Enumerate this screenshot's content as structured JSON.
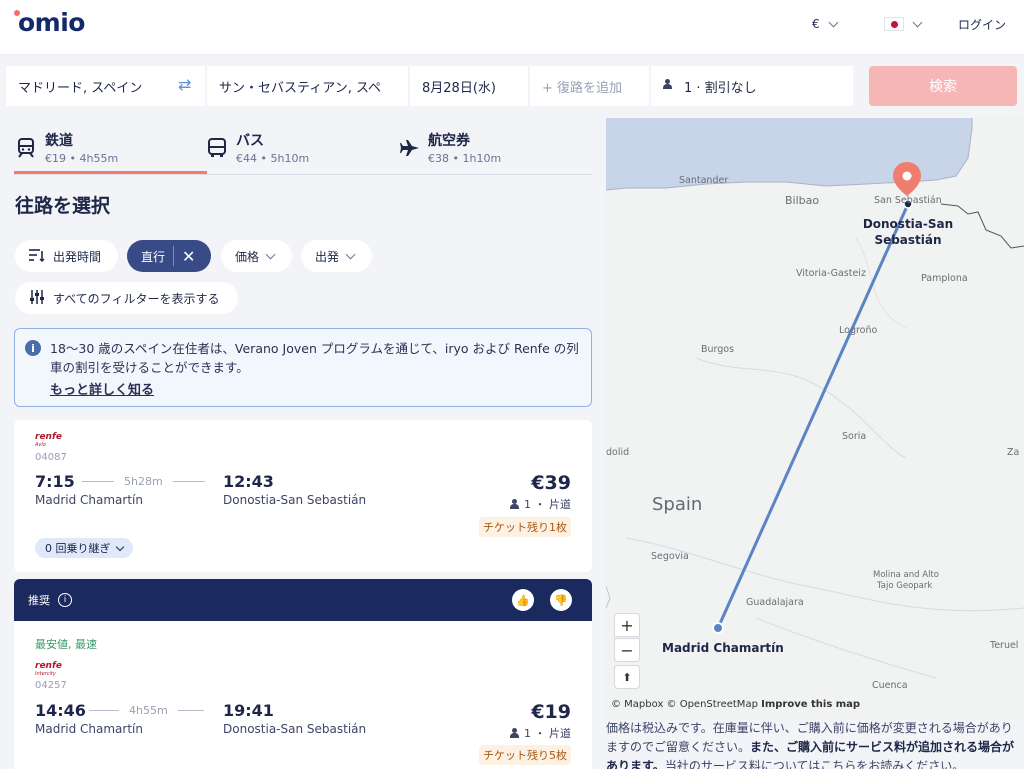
{
  "header": {
    "logo": "omio",
    "currency": "€",
    "login": "ログイン"
  },
  "search": {
    "origin": "マドリード, スペイン",
    "destination": "サン・セバスティアン, スペ",
    "date": "8月28日(水)",
    "return_placeholder": "+ 復路を追加",
    "passengers": "1 · 割引なし",
    "search_button": "検索"
  },
  "tabs": [
    {
      "name": "鉄道",
      "meta": "€19 • 4h55m"
    },
    {
      "name": "バス",
      "meta": "€44 • 5h10m"
    },
    {
      "name": "航空券",
      "meta": "€38 • 1h10m"
    }
  ],
  "section_title": "往路を選択",
  "filters": {
    "departure_time": "出発時間",
    "direct": "直行",
    "price": "価格",
    "departure": "出発",
    "all_filters": "すべてのフィルターを表示する"
  },
  "info": {
    "text": "18〜30 歳のスペイン在住者は、Verano Joven プログラムを通じて、iryo および Renfe の列車の割引を受けることができます。",
    "link": "もっと詳しく知る"
  },
  "results": [
    {
      "brand": "renfe",
      "brand_sub": "Avlo",
      "train_no": "04087",
      "dep_time": "7:15",
      "duration": "5h28m",
      "arr_time": "12:43",
      "dep_station": "Madrid Chamartín",
      "arr_station": "Donostia-San Sebastián",
      "price": "€39",
      "pax": "1 ・ 片道",
      "seats_left": "チケット残り1枚",
      "stops": "0 回乗り継ぎ"
    },
    {
      "recommended": "推奨",
      "tag": "最安値, 最速",
      "brand": "renfe",
      "brand_sub": "Intercity",
      "train_no": "04257",
      "dep_time": "14:46",
      "duration": "4h55m",
      "arr_time": "19:41",
      "dep_station": "Madrid Chamartín",
      "arr_station": "Donostia-San Sebastián",
      "price": "€19",
      "pax": "1 ・ 片道",
      "seats_left": "チケット残り5枚"
    }
  ],
  "map": {
    "labels": {
      "santander": "Santander",
      "bilbao": "Bilbao",
      "san_sebastian": "San Sebastián",
      "vitoria": "Vitoria-Gasteiz",
      "pamplona": "Pamplona",
      "logrono": "Logroño",
      "burgos": "Burgos",
      "soria": "Soria",
      "valladolid": "dolid",
      "zaragoza": "Za",
      "spain": "Spain",
      "segovia": "Segovia",
      "guadalajara": "Guadalajara",
      "molina": "Molina and Alto",
      "molina2": "Tajo Geopark",
      "teruel": "Teruel",
      "cuenca": "Cuenca",
      "origin": "Madrid Chamartín",
      "destination_1": "Donostia-San",
      "destination_2": "Sebastián"
    },
    "zoom_in": "+",
    "zoom_out": "−",
    "compass": "⬆",
    "attribution": "© Mapbox © OpenStreetMap",
    "improve": "Improve this map",
    "accent": "#f07e6e",
    "route_color": "#5b84c4"
  },
  "disclaimer": {
    "part1": "価格は税込みです。在庫量に伴い、ご購入前に価格が変更される場合がありますのでご留意ください。",
    "part2": "また、ご購入前にサービス料が追加される場合があります。",
    "part3": "当社のサービス料についてはこちらをお読みください。"
  }
}
